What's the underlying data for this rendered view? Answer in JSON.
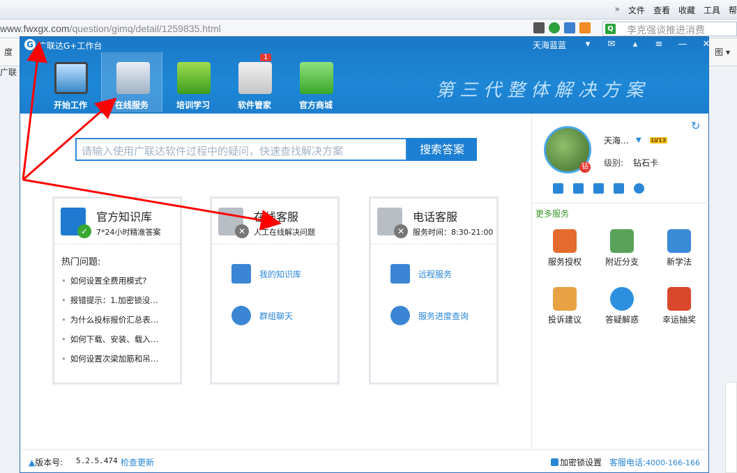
{
  "browser": {
    "menu": [
      "»",
      "文件",
      "查看",
      "收藏",
      "工具",
      "帮"
    ],
    "url_host": "www.fwxgx.com",
    "url_path": "/question/gimq/detail/1259835.html",
    "search_placeholder": "李克强谈推进消费",
    "toolbar_left": "度",
    "toolbar_left2": "广联",
    "toolbar_right": "图 ▾"
  },
  "app": {
    "title": "广联达G+工作台",
    "user": "天海蓝蓝",
    "nav": [
      {
        "label": "开始工作",
        "icon": "monitor-icon"
      },
      {
        "label": "在线服务",
        "icon": "g-logo-icon"
      },
      {
        "label": "培训学习",
        "icon": "ie-icon"
      },
      {
        "label": "软件管家",
        "icon": "software-box-icon",
        "badge": "1"
      },
      {
        "label": "官方商城",
        "icon": "shopping-bag-icon"
      }
    ],
    "slogan": "第三代整体解决方案"
  },
  "search": {
    "placeholder": "请输入使用广联达软件过程中的疑问，快速查找解决方案",
    "button": "搜索答案"
  },
  "cards": {
    "kb": {
      "title": "官方知识库",
      "subtitle": "7*24小时精准答案",
      "hot_title": "热门问题:",
      "items": [
        "如何设置全费用模式?",
        "报错提示：1.加密锁没…",
        "为什么投标报价汇总表…",
        "如何下载、安装、载入…",
        "如何设置次梁加筋和吊…"
      ]
    },
    "online": {
      "title": "在线客服",
      "subtitle": "人工在线解决问题",
      "links": [
        "我的知识库",
        "群组聊天"
      ]
    },
    "phone": {
      "title": "电话客服",
      "subtitle": "服务时间：8:30-21:00",
      "links": [
        "远程服务",
        "服务进度查询"
      ]
    }
  },
  "profile": {
    "name": "天海…",
    "vip": "钻",
    "level_badge": "LV13",
    "level_label": "级别:",
    "level_value": "钻石卡"
  },
  "more_services": {
    "title": "更多服务",
    "items": [
      "服务授权",
      "附近分支",
      "新学法",
      "投诉建议",
      "答疑解惑",
      "幸运抽奖"
    ]
  },
  "status": {
    "version_label": "版本号:",
    "version": "5.2.5.474",
    "update": "检查更新",
    "lock": "加密锁设置",
    "phone_label": "客服电话:",
    "phone": "4000-166-166"
  },
  "colors": {
    "brand_blue": "#1c7fd3",
    "annotation_red": "#ff0000",
    "service_green": "#3a9a2a"
  }
}
